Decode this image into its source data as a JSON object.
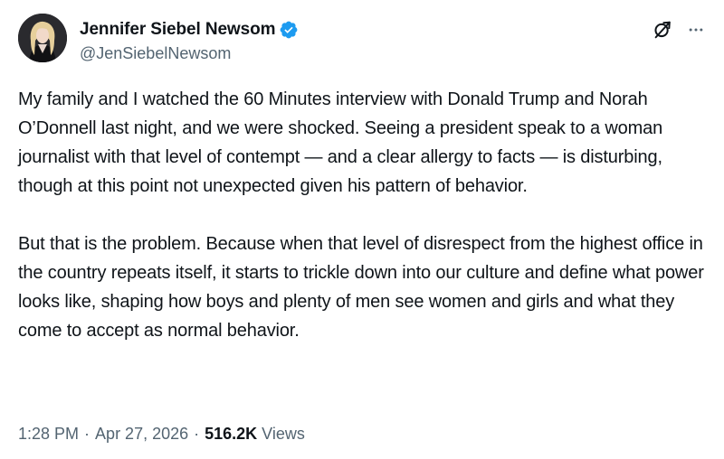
{
  "author": {
    "display_name": "Jennifer Siebel Newsom",
    "handle": "@JenSiebelNewsom",
    "verified_color": "#1d9bf0"
  },
  "icons": {
    "avatar": "profile-photo",
    "verified": "verified-badge-icon",
    "grok": "grok-icon",
    "more": "more-dots-icon"
  },
  "tweet": {
    "paragraphs": [
      "My family and I watched the 60 Minutes interview with Donald Trump and Norah O’Donnell last night, and we were shocked. Seeing a president speak to a woman journalist with that level of contempt — and a clear allergy to facts — is disturbing, though at this point not unexpected given his pattern of behavior.",
      "But that is the problem. Because when that level of disrespect from the highest office in the country repeats itself, it starts to trickle down into our culture and define what power looks like, shaping how boys and plenty of men see women and girls and what they come to accept as normal behavior."
    ]
  },
  "meta": {
    "time": "1:28 PM",
    "separator": "·",
    "date": "Apr 27, 2026",
    "views_count": "516.2K",
    "views_label": "Views"
  }
}
